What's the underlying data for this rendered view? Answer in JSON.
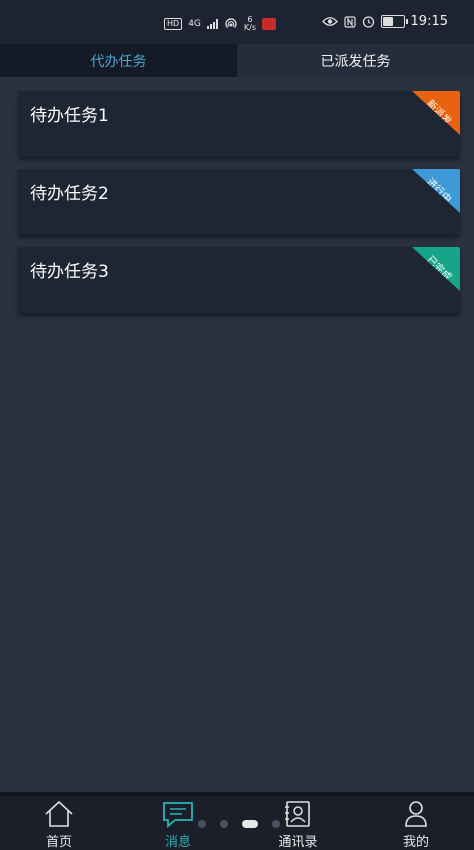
{
  "status_bar": {
    "hd": "HD",
    "network": "4G",
    "speed_value": "6",
    "speed_unit": "K/s",
    "time": "19:15",
    "battery_level": 0.6
  },
  "tabs": [
    {
      "label": "代办任务",
      "active": true
    },
    {
      "label": "已派发任务",
      "active": false
    }
  ],
  "tasks": [
    {
      "title": "待办任务1",
      "status": "新派发",
      "status_color": "#e8620f"
    },
    {
      "title": "待办任务2",
      "status": "进行中",
      "status_color": "#3d9ad6"
    },
    {
      "title": "待办任务3",
      "status": "已完成",
      "status_color": "#17a58a"
    }
  ],
  "nav": {
    "items": [
      {
        "label": "首页",
        "icon": "home-icon",
        "active": false
      },
      {
        "label": "消息",
        "icon": "message-icon",
        "active": true
      },
      {
        "label": "通讯录",
        "icon": "contacts-icon",
        "active": false
      },
      {
        "label": "我的",
        "icon": "user-icon",
        "active": false
      }
    ],
    "active_color": "#2bb3b8"
  },
  "page_indicator": {
    "count": 4,
    "current": 3
  }
}
